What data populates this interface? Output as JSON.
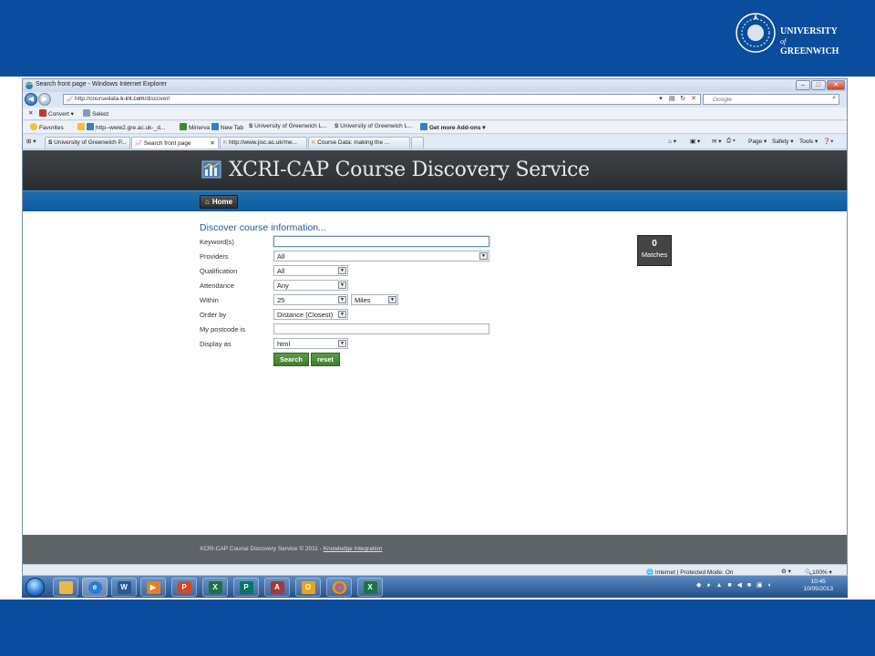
{
  "slide": {
    "university": {
      "line1": "UNIVERSITY",
      "line2": "of",
      "line3": "GREENWICH"
    },
    "colors": {
      "frame": "#0a4d9c"
    }
  },
  "browser": {
    "title": "Search front page - Windows Internet Explorer",
    "address_prefix": "http://coursedata.",
    "address_domain": "k-int.com",
    "address_path": "/discover/",
    "search_placeholder": "Google",
    "command_bar": [
      {
        "icon": "close-icon",
        "label": ""
      },
      {
        "icon": "convert-icon",
        "label": "Convert"
      },
      {
        "icon": "select-icon",
        "label": "Select"
      }
    ],
    "favorites_bar": {
      "favorites_label": "Favorites",
      "items": [
        "http--www2.gre.ac.uk-_d...",
        "Minerva",
        "New Tab",
        "University of Greenwich L...",
        "University of Greenwich L...",
        "Get more Add-ons"
      ]
    },
    "tabs": [
      "University of Greenwich P...",
      "Search front page",
      "http://www.jisc.ac.uk/me...",
      "Course Data: making the ..."
    ],
    "toolbar_right": {
      "page": "Page",
      "safety": "Safety",
      "tools": "Tools"
    },
    "status": {
      "zone": "Internet | Protected Mode: On",
      "zoom": "100%"
    }
  },
  "site": {
    "brand": "XCRI-CAP Course Discovery Service",
    "nav_home": "Home",
    "form_title": "Discover course information...",
    "fields": {
      "keywords": {
        "label": "Keyword(s)",
        "value": ""
      },
      "providers": {
        "label": "Providers",
        "value": "All"
      },
      "qualification": {
        "label": "Qualification",
        "value": "All"
      },
      "attendance": {
        "label": "Attendance",
        "value": "Any"
      },
      "within": {
        "label": "Within",
        "value": "25",
        "unit": "Miles"
      },
      "order_by": {
        "label": "Order by",
        "value": "Distance (Closest)"
      },
      "postcode": {
        "label": "My postcode is",
        "value": ""
      },
      "display_as": {
        "label": "Display as",
        "value": "html"
      }
    },
    "buttons": {
      "search": "Search",
      "reset": "reset"
    },
    "matches": {
      "count": "0",
      "label": "Matches"
    },
    "footer": {
      "text": "XCRI-CAP Course Discovery Service © 2011 - ",
      "link": "Knowledge Integration"
    }
  },
  "taskbar": {
    "clock_time": "10:45",
    "clock_date": "10/05/2013",
    "apps": [
      "explorer",
      "internet-explorer",
      "word",
      "media-player",
      "powerpoint",
      "excel",
      "publisher",
      "access",
      "outlook",
      "chrome",
      "excel-2"
    ]
  }
}
